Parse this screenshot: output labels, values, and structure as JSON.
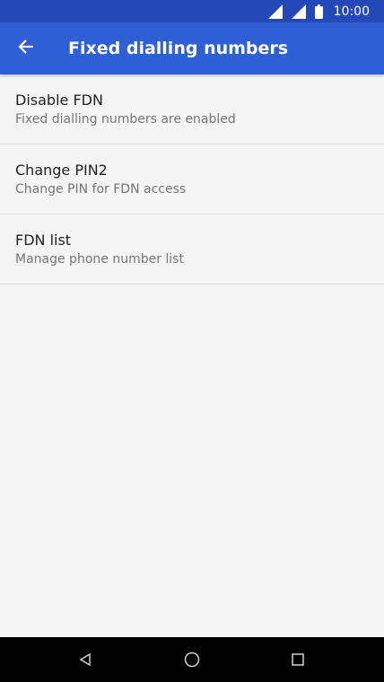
{
  "status_bar": {
    "time": "10:00",
    "background": "#2448b8",
    "icons": [
      "signal-icon",
      "signal-icon",
      "battery-icon"
    ]
  },
  "app_bar": {
    "title": "Fixed dialling numbers",
    "background": "#2f5fd6",
    "back_icon": "arrow-left-icon"
  },
  "list": {
    "items": [
      {
        "title": "Disable FDN",
        "subtitle": "Fixed dialling numbers are enabled"
      },
      {
        "title": "Change PIN2",
        "subtitle": "Change PIN for FDN access"
      },
      {
        "title": "FDN list",
        "subtitle": "Manage phone number list"
      }
    ]
  },
  "nav_bar": {
    "background": "#000000",
    "icons": [
      "back-triangle-icon",
      "home-circle-icon",
      "recents-square-icon"
    ]
  }
}
